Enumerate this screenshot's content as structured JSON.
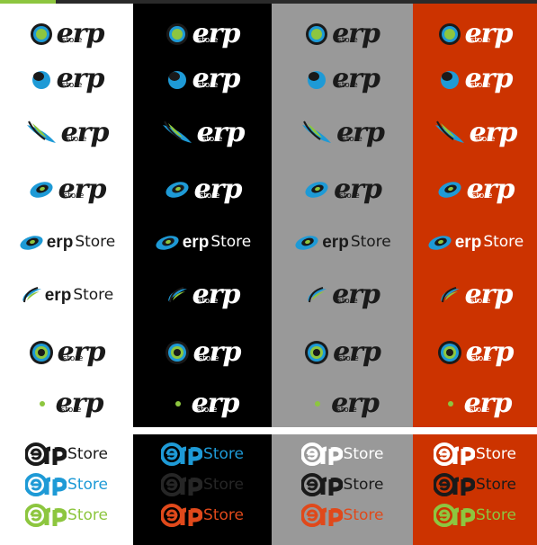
{
  "script_logo": {
    "word": "erp",
    "sub": "store"
  },
  "wordmark": {
    "erp": "erp",
    "store": "Store"
  },
  "columns": [
    {
      "name": "white",
      "bg": "#ffffff",
      "text": "#1a1a1a"
    },
    {
      "name": "black",
      "bg": "#000000",
      "text": "#ffffff"
    },
    {
      "name": "gray",
      "bg": "#999999",
      "text": "#1a1a1a"
    },
    {
      "name": "red",
      "bg": "#cc3300",
      "text": "#ffffff"
    }
  ],
  "colors": {
    "blue": "#1e9ad6",
    "green": "#8dc63f",
    "dark": "#1a1a1a",
    "orange": "#e0491b"
  },
  "icons": [
    "circle-badge-icon",
    "drop-badge-icon",
    "swoosh-icon",
    "ellipse-badge-icon",
    "swoosh-wordmark-icon",
    "half-swoosh-icon",
    "ring-badge-icon",
    "crescent-badge-icon"
  ],
  "mono_rows": [
    [
      "#1a1a1a",
      "#1e9ad6",
      "#ffffff",
      "#ffffff"
    ],
    [
      "#1e9ad6",
      "#262626",
      "#1a1a1a",
      "#1a1a1a"
    ],
    [
      "#8dc63f",
      "#e0491b",
      "#e0491b",
      "#8dc63f"
    ]
  ]
}
